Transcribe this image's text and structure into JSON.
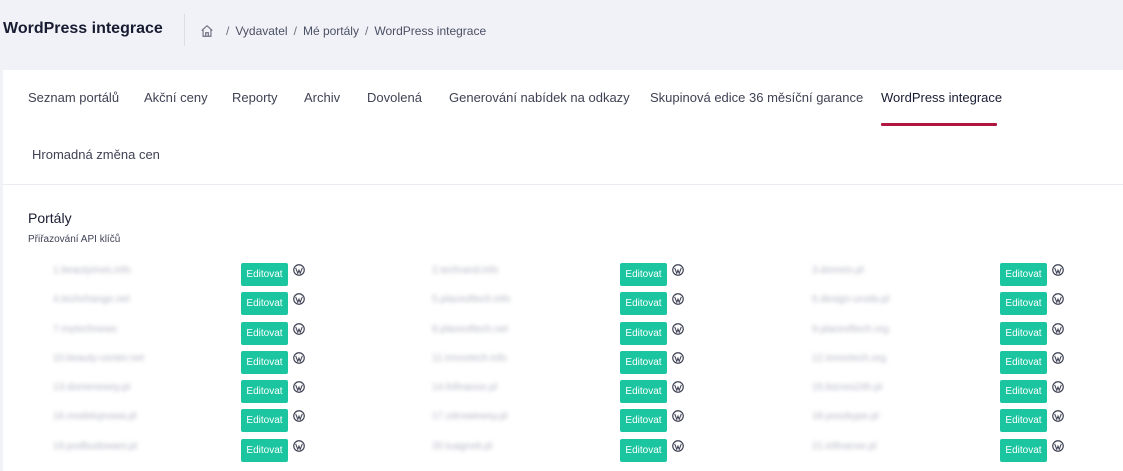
{
  "header": {
    "title": "WordPress integrace",
    "breadcrumb": [
      "Vydavatel",
      "Mé portály",
      "WordPress integrace"
    ]
  },
  "tabs": [
    {
      "label": "Seznam portálů"
    },
    {
      "label": "Akční ceny"
    },
    {
      "label": "Reporty"
    },
    {
      "label": "Archiv"
    },
    {
      "label": "Dovolená"
    },
    {
      "label": "Generování nabídek na odkazy"
    },
    {
      "label": "Skupinová edice 36 měsíční garance"
    },
    {
      "label": "WordPress integrace",
      "active": true
    },
    {
      "label": "Hromadná změna cen"
    }
  ],
  "section": {
    "title": "Portály",
    "subtitle": "Přiřazování API klíčů"
  },
  "edit_label": "Editovat",
  "colors": {
    "accent": "#b0163f",
    "button": "#1bc5a0"
  },
  "portals": [
    [
      "1.beautyinvio.info",
      "2.techrand.info",
      "3.domein.pl"
    ],
    [
      "4.techchange.net",
      "5.placeoftech.info",
      "6.design-uroda.pl"
    ],
    [
      "7.mytechnews",
      "8.placeoftech.net",
      "9.placeoftech.org"
    ],
    [
      "10.beauty-center.net",
      "11.innovtech.info",
      "12.innovtech.org"
    ],
    [
      "13.domenewsy.pl",
      "14.fofinance.pl",
      "15.biznes24h.pl"
    ],
    [
      "16.modelujnowa.pl",
      "17.zdrowiewsy.pl",
      "18.poszkype.pl"
    ],
    [
      "19.podbudowani.pl",
      "20.tuagnoti.pl",
      "21.infinanse.pl"
    ]
  ]
}
